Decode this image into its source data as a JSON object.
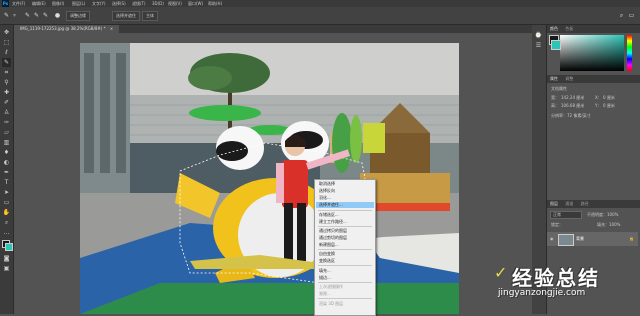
{
  "app": {
    "logo": "Ps"
  },
  "menubar": {
    "items": [
      "文件(F)",
      "编辑(E)",
      "图像(I)",
      "图层(L)",
      "文字(Y)",
      "选择(S)",
      "滤镜(T)",
      "3D(D)",
      "视图(V)",
      "窗口(W)",
      "帮助(H)"
    ]
  },
  "optionsbar": {
    "btn1": "调整边缘",
    "btn2": "选择并遮住",
    "btn3": "主体"
  },
  "document_tab": {
    "label": "IMG_1119-172253.jpg @ 38.2%(RGB/8#) *"
  },
  "right_panel": {
    "color_tab": "颜色",
    "swatches_tab": "色板",
    "properties_tab": "属性",
    "adjust_tab": "调整",
    "doc_props": "文档属性",
    "w_label": "宽：",
    "w_value": "142.24 厘米",
    "h_label": "高：",
    "h_value": "106.68 厘米",
    "x_label": "X：",
    "x_value": "0 厘米",
    "y_label": "Y：",
    "y_value": "0 厘米",
    "res": "分辨率：72 像素/英寸",
    "layers_tab": "图层",
    "channels_tab": "通道",
    "paths_tab": "路径",
    "mode": "正常",
    "opacity": "不透明度：100%",
    "lock": "锁定：",
    "fill": "填充：100%",
    "layer_name": "背景"
  },
  "context_menu": {
    "items": [
      {
        "label": "取消选择",
        "state": "normal"
      },
      {
        "label": "选择反向",
        "state": "normal"
      },
      {
        "label": "羽化...",
        "state": "normal"
      },
      {
        "label": "选择并遮住...",
        "state": "highlighted"
      },
      {
        "label": "存储选区...",
        "state": "normal"
      },
      {
        "label": "建立工作路径...",
        "state": "normal"
      },
      {
        "label": "通过拷贝的图层",
        "state": "normal"
      },
      {
        "label": "通过剪切的图层",
        "state": "normal"
      },
      {
        "label": "新建图层...",
        "state": "normal"
      },
      {
        "label": "自由变换",
        "state": "normal"
      },
      {
        "label": "变换选区",
        "state": "normal"
      },
      {
        "label": "填充...",
        "state": "normal"
      },
      {
        "label": "描边...",
        "state": "normal"
      },
      {
        "label": "上次滤镜操作",
        "state": "disabled"
      },
      {
        "label": "渐隐...",
        "state": "disabled"
      },
      {
        "label": "渲染 3D 图层",
        "state": "disabled"
      }
    ]
  },
  "watermark": {
    "title": "经验总结",
    "url": "jingyanzongjie.com"
  },
  "colors": {
    "accent": "#91c9f7",
    "app_bg": "#535353",
    "ps_blue": "#31a8ff"
  }
}
